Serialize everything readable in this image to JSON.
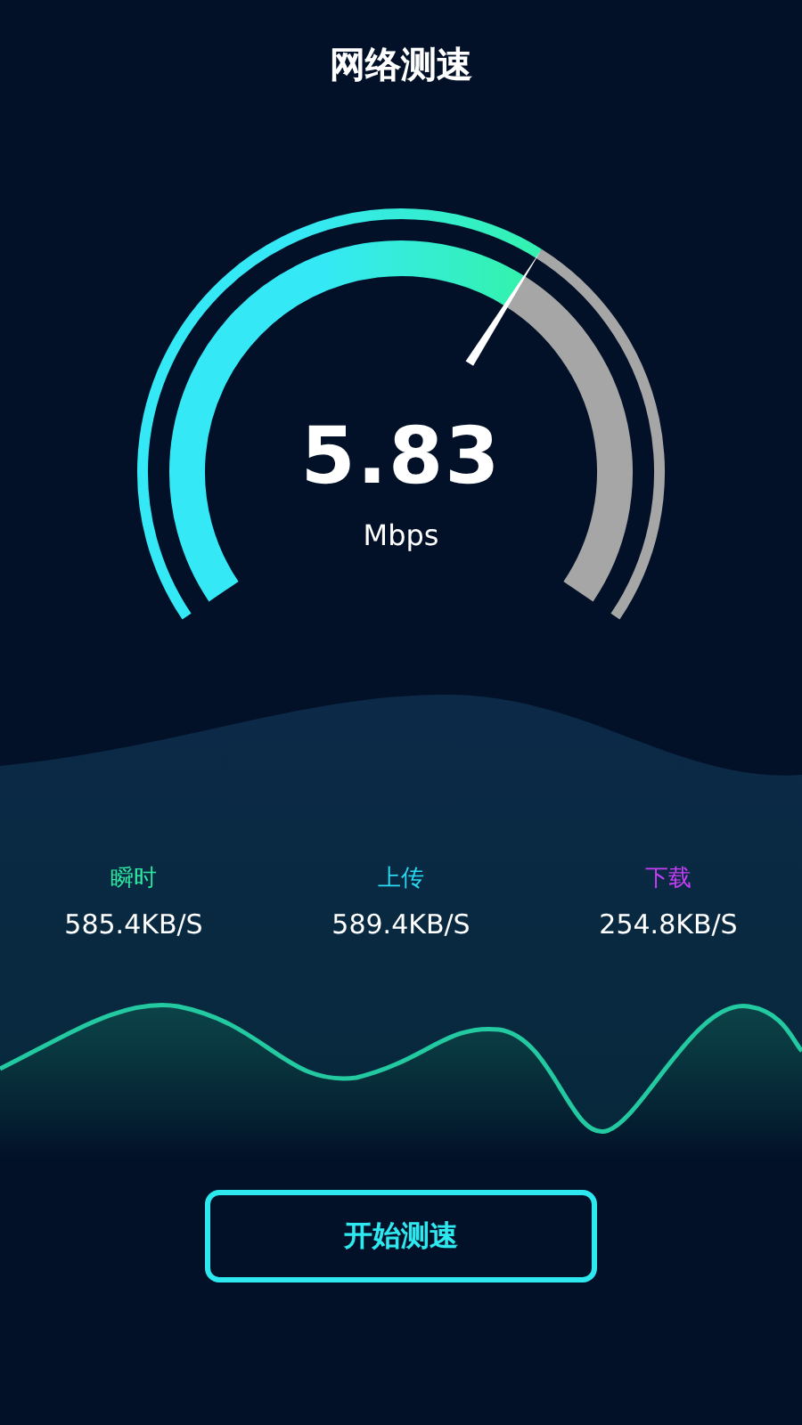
{
  "title": "网络测速",
  "gauge": {
    "value": "5.83",
    "unit": "Mbps"
  },
  "stats": [
    {
      "label": "瞬时",
      "value": "585.4KB/S",
      "color": "#2ee6a0"
    },
    {
      "label": "上传",
      "value": "589.4KB/S",
      "color": "#2ad8ef"
    },
    {
      "label": "下载",
      "value": "254.8KB/S",
      "color": "#c63ef5"
    }
  ],
  "button": "开始测速"
}
